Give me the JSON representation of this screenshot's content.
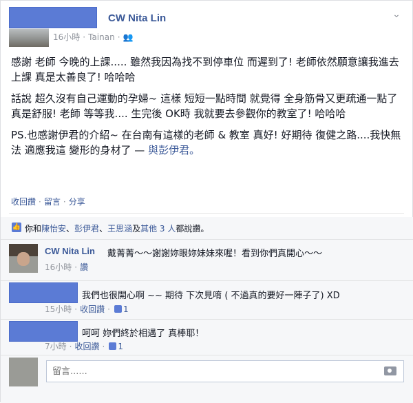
{
  "post": {
    "author": "CW Nita Lin",
    "time": "16小時",
    "location": "Tainan",
    "paragraphs": [
      "感謝 老師 今晚的上課..... 雖然我因為找不到停車位 而遲到了! 老師依然願意讓我進去上課 真是太善良了! 哈哈哈",
      "話說 超久沒有自己運動的孕婦~ 這樣 短短一點時間 就覺得 全身筋骨又更疏通一點了 真是舒服! 老師 等等我.... 生完後 OK時 我就要去參觀你的教室了! 哈哈哈",
      "PS.也感謝伊君的介紹~ 在台南有這樣的老師 & 教室 真好! 好期待 復健之路....我快無法 適應我這 變形的身材了 —"
    ],
    "tag_text": "與彭伊君。",
    "actions": [
      "收回讚",
      "留言",
      "分享"
    ]
  },
  "likes": {
    "prefix": "你和",
    "names": [
      "陳怡安",
      "彭伊君",
      "王思涵"
    ],
    "others": "其他 3 人",
    "suffix": "都說讚。"
  },
  "comments": [
    {
      "name": "CW Nita Lin",
      "text": "戴菁菁～～謝謝妳眼妳妹妹來喔！看到你們真開心～～",
      "time": "16小時",
      "action": "讚"
    },
    {
      "name": "",
      "text": "我們也很開心啊 ~~ 期待 下次見唷 ( 不過真的要好一陣子了) XD",
      "time": "15小時",
      "action": "收回讚",
      "likes": "1"
    },
    {
      "name": "",
      "text": "呵呵 妳們終於相遇了 真棒耶！",
      "time": "7小時",
      "action": "收回讚",
      "likes": "1"
    }
  ],
  "reply": {
    "placeholder": "留言......"
  },
  "colors": {
    "link": "#3b5998",
    "meta": "#90949c",
    "redact": "#5b7bd5"
  }
}
